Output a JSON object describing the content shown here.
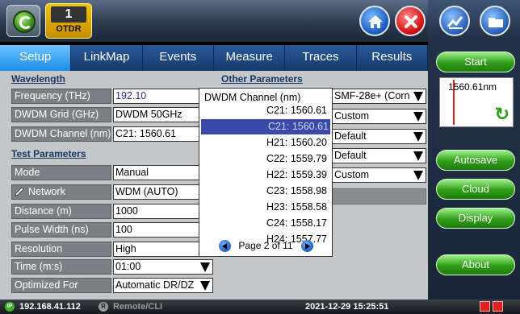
{
  "header": {
    "module_number": "1",
    "module_label": "OTDR"
  },
  "tabs": [
    {
      "label": "Setup",
      "active": true
    },
    {
      "label": "LinkMap",
      "active": false
    },
    {
      "label": "Events",
      "active": false
    },
    {
      "label": "Measure",
      "active": false
    },
    {
      "label": "Traces",
      "active": false
    },
    {
      "label": "Results",
      "active": false
    }
  ],
  "wavelength": {
    "section_title": "Wavelength",
    "rows": [
      {
        "label": "Frequency (THz)",
        "value": "192.10"
      },
      {
        "label": "DWDM Grid (GHz)",
        "value": "DWDM 50GHz"
      },
      {
        "label": "DWDM Channel (nm)",
        "value": "C21: 1560.61"
      }
    ]
  },
  "test_parameters": {
    "section_title": "Test Parameters",
    "rows": [
      {
        "label": "Mode",
        "value": "Manual"
      },
      {
        "label": "Network",
        "value": "WDM (AUTO)"
      },
      {
        "label": "Distance (m)",
        "value": "1000"
      },
      {
        "label": "Pulse Width (ns)",
        "value": "100"
      },
      {
        "label": "Resolution",
        "value": "High"
      },
      {
        "label": "Time (m:s)",
        "value": "01:00"
      },
      {
        "label": "Optimized For",
        "value": "Automatic DR/DZ"
      }
    ]
  },
  "other_parameters": {
    "section_title": "Other Parameters",
    "values": [
      "SMF-28e+ (Corn",
      "Custom",
      "Default",
      "Default",
      "Custom"
    ]
  },
  "dropdown": {
    "title": "DWDM Channel (nm)",
    "current": "C21: 1560.61",
    "options": [
      {
        "label": "C21: 1560.61",
        "selected": true
      },
      {
        "label": "H21: 1560.20",
        "selected": false
      },
      {
        "label": "C22: 1559.79",
        "selected": false
      },
      {
        "label": "H22: 1559.39",
        "selected": false
      },
      {
        "label": "C23: 1558.98",
        "selected": false
      },
      {
        "label": "H23: 1558.58",
        "selected": false
      },
      {
        "label": "C24: 1558.17",
        "selected": false
      },
      {
        "label": "H24: 1557.77",
        "selected": false
      }
    ],
    "pager": "Page 2 of 11"
  },
  "sidebar": {
    "start_label": "Start",
    "preview_wavelength": "1560.61nm",
    "autosave_label": "Autosave",
    "cloud_label": "Cloud",
    "display_label": "Display",
    "about_label": "About"
  },
  "status": {
    "ip_badge": "IP",
    "ip": "192.168.41.112",
    "remote_badge": "R",
    "remote": "Remote/CLI",
    "datetime": "2021-12-29  15:25:51"
  },
  "colors": {
    "accent_blue": "#1c8ce6",
    "green_button": "#2f9d18",
    "selection": "#3b4aa8"
  }
}
